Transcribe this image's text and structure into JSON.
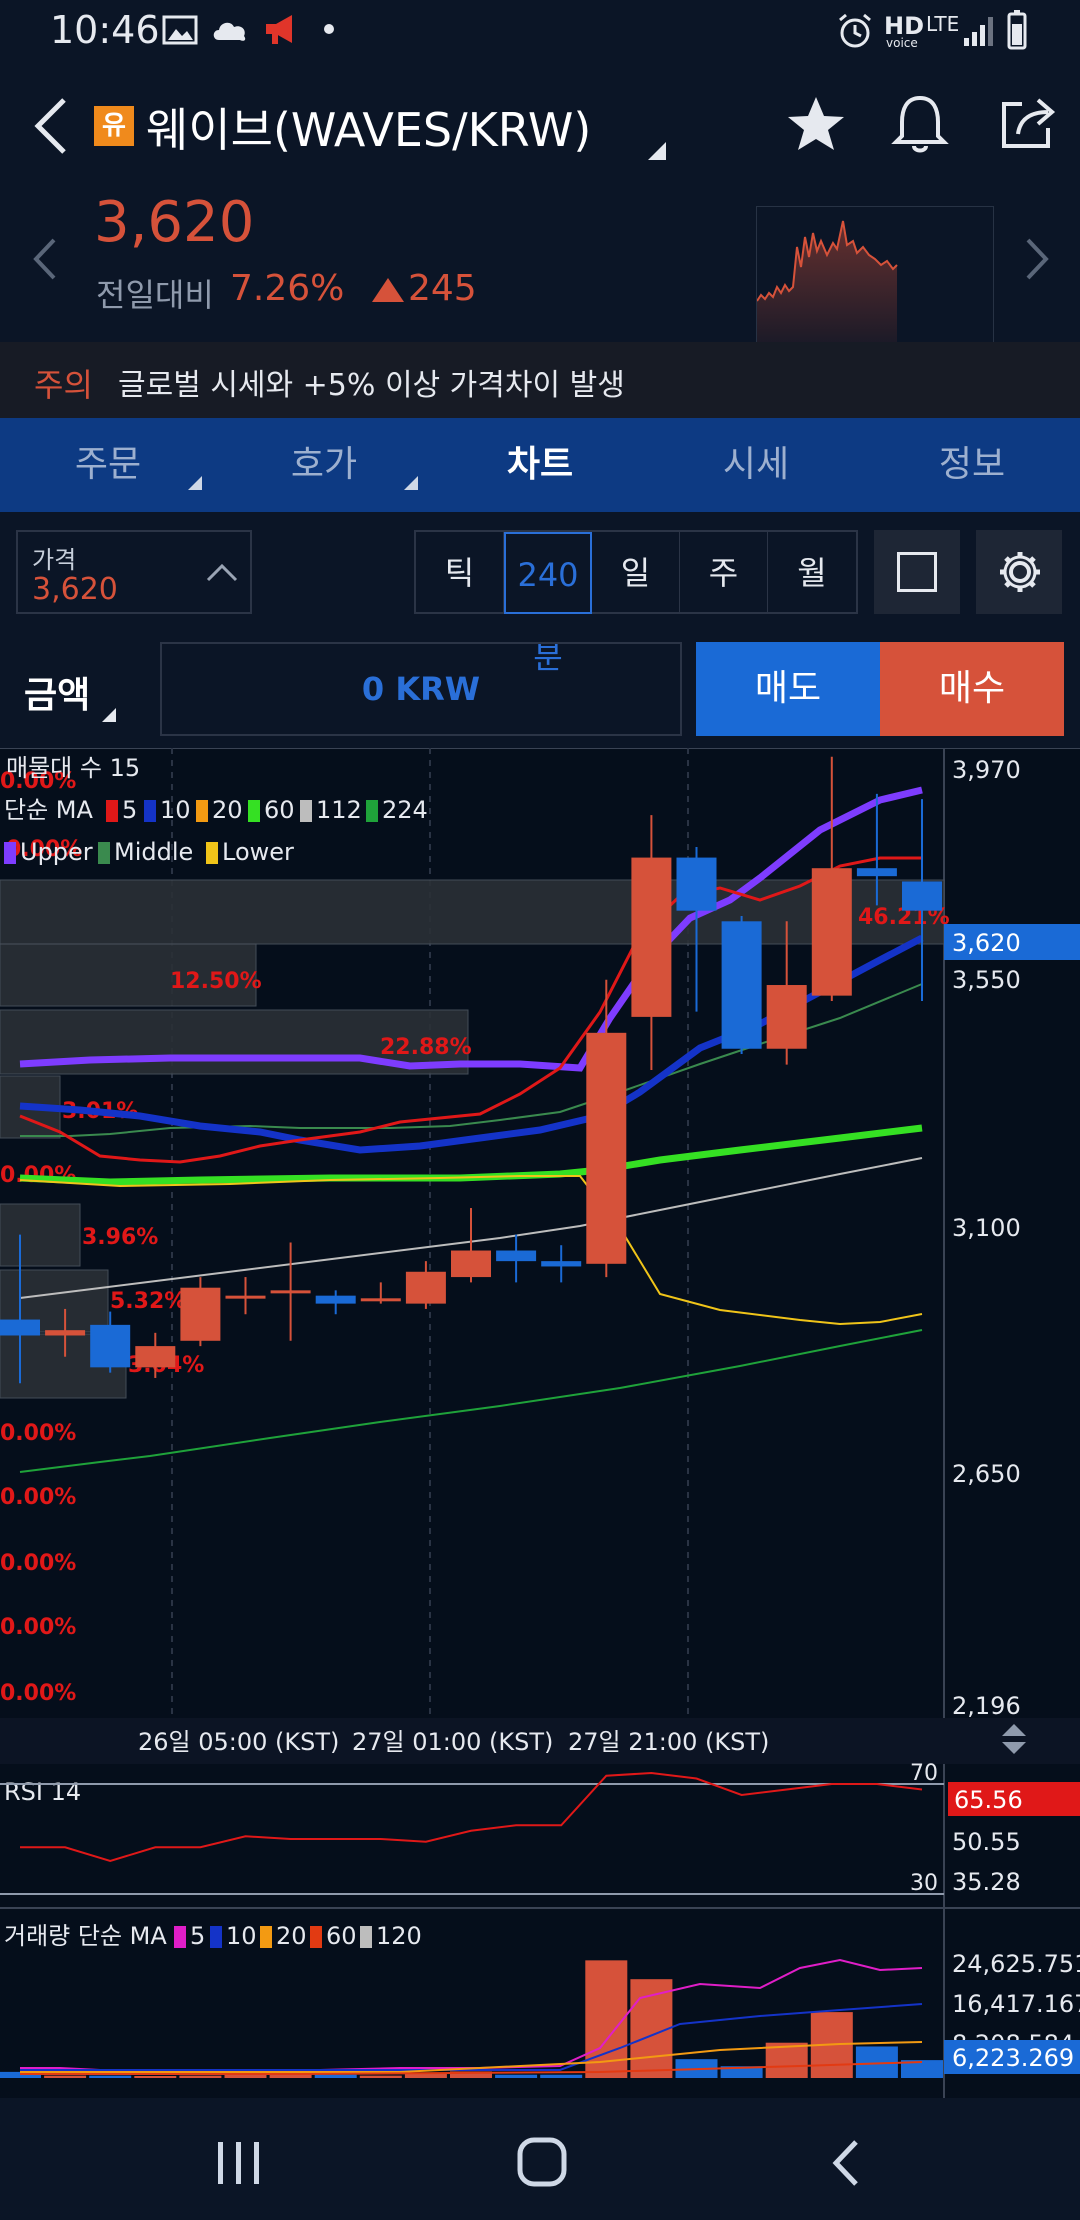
{
  "status_bar": {
    "time": "10:46",
    "right_labels": [
      "HD",
      "voice",
      "LTE"
    ]
  },
  "header": {
    "badge": "유",
    "title": "웨이브(WAVES/KRW)",
    "price": "3,620",
    "change_label": "전일대비",
    "change_percent": "7.26%",
    "change_amount": "245",
    "accent_up": "#d6523a",
    "accent_down": "#1a6ad6"
  },
  "notice": {
    "label": "주의",
    "text": "글로벌 시세와 +5% 이상 가격차이 발생"
  },
  "tabs": [
    {
      "label": "주문"
    },
    {
      "label": "호가"
    },
    {
      "label": "차트"
    },
    {
      "label": "시세"
    },
    {
      "label": "정보"
    }
  ],
  "controls": {
    "price_label": "가격",
    "price_value": "3,620",
    "periods": [
      "틱",
      "240분",
      "일",
      "주",
      "월"
    ],
    "selected_period": "240분",
    "amount_label": "금액",
    "amount_value": "0 KRW",
    "sell_label": "매도",
    "buy_label": "매수"
  },
  "chart_legend": {
    "volume_profile": "매물대 수 15",
    "ma_title": "단순 MA",
    "ma_items": [
      "5",
      "10",
      "20",
      "60",
      "112",
      "224"
    ],
    "ma_colors": [
      "#e01818",
      "#1433c8",
      "#f39a12",
      "#35e023",
      "#bdbdbd",
      "#1fa23a"
    ],
    "bb_items": [
      "Upper",
      "Middle",
      "Lower"
    ],
    "bb_colors": [
      "#7e3cff",
      "#3a8a4e",
      "#f0c419"
    ]
  },
  "profile_labels": [
    "0.00%",
    "0.00%",
    "12.50%",
    "22.88%",
    "3.01%",
    "0.00%",
    "3.96%",
    "5.32%",
    "3.04%",
    "0.00%",
    "0.00%",
    "0.00%",
    "0.00%",
    "0.00%",
    "46.21%"
  ],
  "y_axis": [
    "3,970",
    "3,550",
    "3,100",
    "2,650",
    "2,196"
  ],
  "current_price_tag": "3,620",
  "x_axis": [
    "26일 05:00 (KST)",
    "27일 01:00 (KST)",
    "27일 21:00 (KST)"
  ],
  "rsi": {
    "title": "RSI 14",
    "upper": "70",
    "lower": "30",
    "value_tag": "65.56",
    "axis": [
      "50.55",
      "35.28"
    ]
  },
  "volume": {
    "title": "거래량 단순 MA",
    "ma_items": [
      "5",
      "10",
      "20",
      "60",
      "120"
    ],
    "ma_colors": [
      "#e01ec8",
      "#1433c8",
      "#f39a12",
      "#e23a12",
      "#bdbdbd"
    ],
    "axis": [
      "24,625.751",
      "16,417.167",
      "8,208.584"
    ],
    "value_tag": "6,223.269"
  },
  "chart_data": {
    "type": "candlestick",
    "interval": "240분",
    "y_range": [
      2196,
      3970
    ],
    "candles": [
      {
        "open": 2920,
        "close": 2890,
        "high": 3080,
        "low": 2800
      },
      {
        "open": 2890,
        "close": 2900,
        "high": 2940,
        "low": 2850
      },
      {
        "open": 2910,
        "close": 2830,
        "high": 2935,
        "low": 2820
      },
      {
        "open": 2830,
        "close": 2870,
        "high": 2895,
        "low": 2810
      },
      {
        "open": 2880,
        "close": 2980,
        "high": 3000,
        "low": 2870
      },
      {
        "open": 2965,
        "close": 2965,
        "high": 3000,
        "low": 2930
      },
      {
        "open": 2975,
        "close": 2975,
        "high": 3065,
        "low": 2880
      },
      {
        "open": 2965,
        "close": 2950,
        "high": 2975,
        "low": 2930
      },
      {
        "open": 2960,
        "close": 2960,
        "high": 2990,
        "low": 2950
      },
      {
        "open": 2950,
        "close": 3010,
        "high": 3030,
        "low": 2940
      },
      {
        "open": 3000,
        "close": 3050,
        "high": 3130,
        "low": 2990
      },
      {
        "open": 3050,
        "close": 3030,
        "high": 3080,
        "low": 2990
      },
      {
        "open": 3030,
        "close": 3020,
        "high": 3060,
        "low": 2990
      },
      {
        "open": 3025,
        "close": 3460,
        "high": 3560,
        "low": 3000
      },
      {
        "open": 3490,
        "close": 3790,
        "high": 3870,
        "low": 3390
      },
      {
        "open": 3790,
        "close": 3690,
        "high": 3810,
        "low": 3500
      },
      {
        "open": 3670,
        "close": 3430,
        "high": 3680,
        "low": 3420
      },
      {
        "open": 3430,
        "close": 3550,
        "high": 3670,
        "low": 3400
      },
      {
        "open": 3530,
        "close": 3770,
        "high": 3980,
        "low": 3520
      },
      {
        "open": 3770,
        "close": 3755,
        "high": 3910,
        "low": 3700
      },
      {
        "open": 3745,
        "close": 3690,
        "high": 3900,
        "low": 3520
      }
    ],
    "rsi": [
      47,
      47,
      42,
      47,
      47,
      51,
      50,
      50,
      50,
      49,
      53,
      55,
      55,
      73,
      74,
      72,
      66,
      68,
      70,
      70,
      68
    ],
    "volume": [
      1300,
      500,
      500,
      400,
      500,
      700,
      800,
      700,
      500,
      1000,
      1400,
      700,
      700,
      25000,
      21000,
      4000,
      2500,
      7500,
      14000,
      6700,
      3800
    ]
  }
}
